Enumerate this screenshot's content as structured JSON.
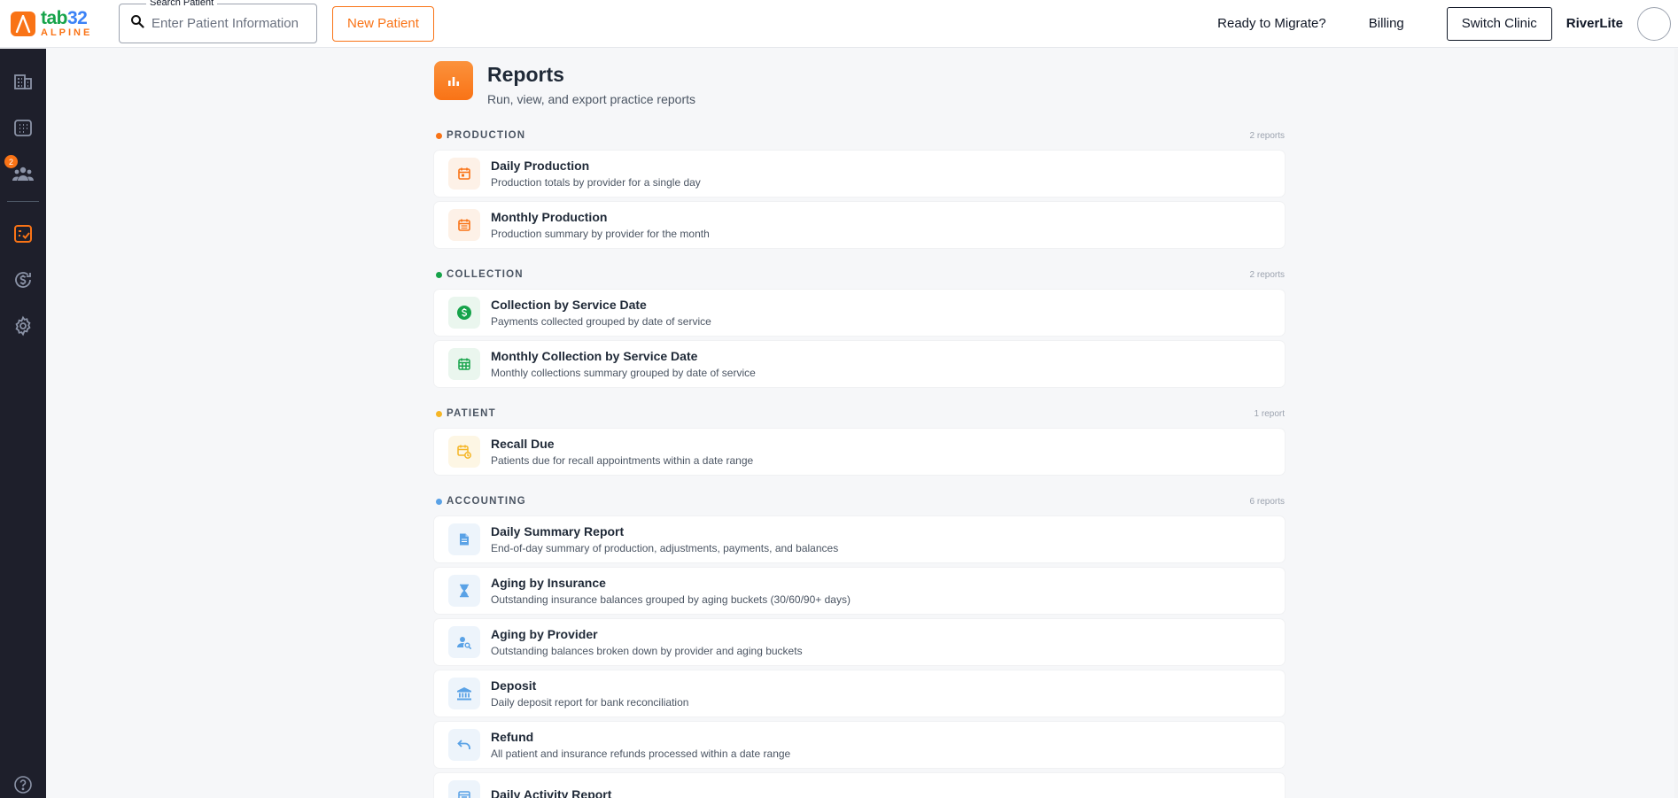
{
  "header": {
    "logo_word_a": "tab",
    "logo_word_b": "32",
    "logo_sub": "ALPINE",
    "search_label": "Search Patient",
    "search_placeholder": "Enter Patient Information",
    "new_patient_label": "New Patient",
    "migrate_label": "Ready to Migrate?",
    "billing_label": "Billing",
    "switch_clinic_label": "Switch Clinic",
    "clinic_name": "RiverLite"
  },
  "sidebar": {
    "patients_badge": "2"
  },
  "page": {
    "title": "Reports",
    "subtitle": "Run, view, and export practice reports"
  },
  "sections": [
    {
      "title": "PRODUCTION",
      "count": "2 reports",
      "color": "#f97316",
      "reports": [
        {
          "title": "Daily Production",
          "desc": "Production totals by provider for a single day",
          "icon": "calendar-icon"
        },
        {
          "title": "Monthly Production",
          "desc": "Production summary by provider for the month",
          "icon": "calendar-month-icon"
        }
      ]
    },
    {
      "title": "COLLECTION",
      "count": "2 reports",
      "color": "#16a34a",
      "reports": [
        {
          "title": "Collection by Service Date",
          "desc": "Payments collected grouped by date of service",
          "icon": "dollar-icon"
        },
        {
          "title": "Monthly Collection by Service Date",
          "desc": "Monthly collections summary grouped by date of service",
          "icon": "calendar-grid-icon"
        }
      ]
    },
    {
      "title": "PATIENT",
      "count": "1 report",
      "color": "#f5b626",
      "reports": [
        {
          "title": "Recall Due",
          "desc": "Patients due for recall appointments within a date range",
          "icon": "calendar-recall-icon"
        }
      ]
    },
    {
      "title": "ACCOUNTING",
      "count": "6 reports",
      "color": "#5aa2e6",
      "reports": [
        {
          "title": "Daily Summary Report",
          "desc": "End-of-day summary of production, adjustments, payments, and balances",
          "icon": "document-icon"
        },
        {
          "title": "Aging by Insurance",
          "desc": "Outstanding insurance balances grouped by aging buckets (30/60/90+ days)",
          "icon": "hourglass-icon"
        },
        {
          "title": "Aging by Provider",
          "desc": "Outstanding balances broken down by provider and aging buckets",
          "icon": "person-search-icon"
        },
        {
          "title": "Deposit",
          "desc": "Daily deposit report for bank reconciliation",
          "icon": "bank-icon"
        },
        {
          "title": "Refund",
          "desc": "All patient and insurance refunds processed within a date range",
          "icon": "undo-icon"
        },
        {
          "title": "Daily Activity Report",
          "desc": "",
          "icon": "activity-icon"
        }
      ]
    }
  ]
}
